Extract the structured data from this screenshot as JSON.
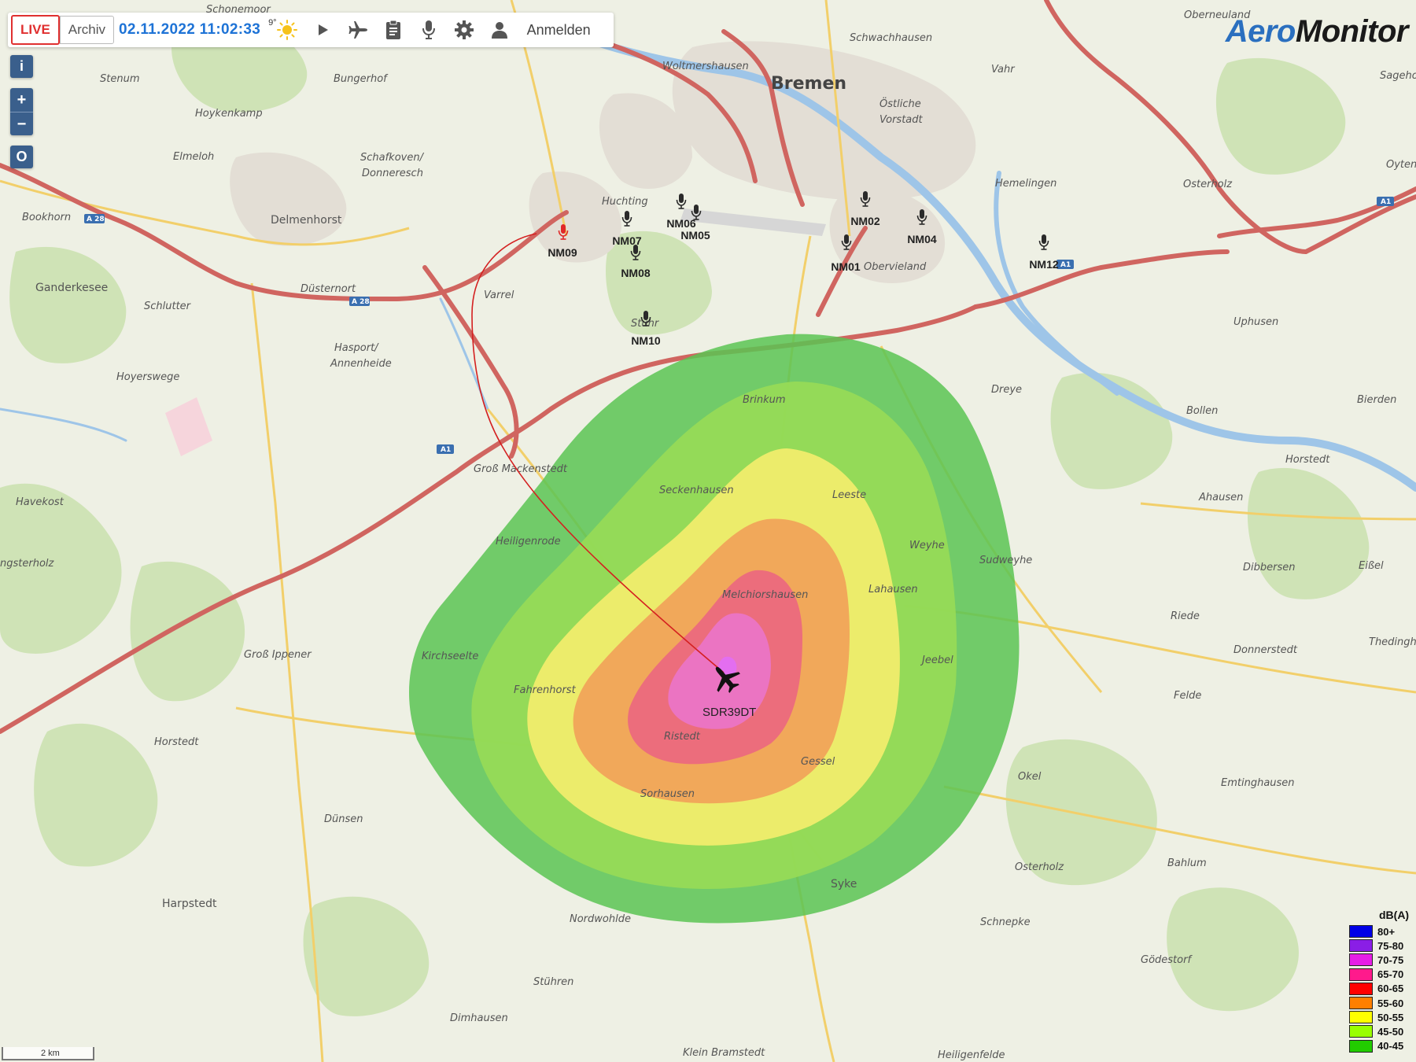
{
  "toolbar": {
    "live_label": "LIVE",
    "archive_label": "Archiv",
    "datetime": "02.11.2022 11:02:33",
    "temperature": "9°",
    "weather_icon": "sun-icon",
    "login_label": "Anmelden",
    "icons": [
      "play-icon",
      "airplane-icon",
      "clipboard-icon",
      "microphone-icon",
      "gear-icon",
      "user-icon"
    ]
  },
  "controls": {
    "info": "i",
    "zoom_in": "+",
    "zoom_out": "−",
    "overview": "O"
  },
  "logo": {
    "part1": "Aero",
    "part2": "Monitor"
  },
  "places": {
    "bremen": "Bremen",
    "schwachhausen": "Schwachhausen",
    "oestliche": "Östliche",
    "vorstadt": "Vorstadt",
    "vahr": "Vahr",
    "woltmershausen": "Woltmershausen",
    "schonemoor": "Schonemoor",
    "stenum": "Stenum",
    "bungerhof": "Bungerhof",
    "hoykenkamp": "Hoykenkamp",
    "elmeloh": "Elmeloh",
    "schafkoven": "Schafkoven/",
    "donneresch": "Donneresch",
    "huchting": "Huchting",
    "delmenhorst": "Delmenhorst",
    "bookhorn": "Bookhorn",
    "ganderkesee": "Ganderkesee",
    "schlutter": "Schlutter",
    "duesternort": "Düsternort",
    "varrel": "Varrel",
    "hasport": "Hasport/",
    "annenheide": "Annenheide",
    "hoyerswege": "Hoyerswege",
    "stuhr": "Stuhr",
    "brinkum": "Brinkum",
    "hemelingen": "Hemelingen",
    "osterholz_n": "Osterholz",
    "oberneuland": "Oberneuland",
    "sagehorn": "Sageho",
    "oyten": "Oyten",
    "obervieland": "Obervieland",
    "uphusen": "Uphusen",
    "dreye": "Dreye",
    "bollen": "Bollen",
    "bierden": "Bierden",
    "horstedt_e": "Horstedt",
    "ahausen": "Ahausen",
    "gross_mackenstedt": "Groß Mackenstedt",
    "seckenhausen": "Seckenhausen",
    "leeste": "Leeste",
    "weyhe": "Weyhe",
    "sudweyhe": "Sudweyhe",
    "havekost": "Havekost",
    "heiligenrode": "Heiligenrode",
    "ngsterholz": "ngsterholz",
    "melchiorshausen": "Melchiorshausen",
    "lahausen": "Lahausen",
    "dibbersen": "Dibbersen",
    "eissel": "Eißel",
    "riede": "Riede",
    "kirchseelte": "Kirchseelte",
    "gross_ippener": "Groß Ippener",
    "jeebel": "Jeebel",
    "donnerstedt": "Donnerstedt",
    "thedinghausen": "Thedingh",
    "fahrenhorst": "Fahrenhorst",
    "ristedt": "Ristedt",
    "felde": "Felde",
    "horstedt_w": "Horstedt",
    "gessel": "Gessel",
    "okel": "Okel",
    "sorhausen": "Sorhausen",
    "emtinghausen": "Emtinghausen",
    "duensen": "Dünsen",
    "osterholz_s": "Osterholz",
    "syke": "Syke",
    "bahlum": "Bahlum",
    "harpstedt": "Harpstedt",
    "nordwohlde": "Nordwohlde",
    "schnepke": "Schnepke",
    "goedestorf": "Gödestorf",
    "stuehren": "Stühren",
    "dimhausen": "Dimhausen",
    "klein_bramstedt": "Klein Bramstedt",
    "heiligenfelde": "Heiligenfelde"
  },
  "roads": {
    "a1_e": "A1",
    "a28_w": "A 28",
    "a28_m": "A 28",
    "a1_m": "A1",
    "a1_n": "A1"
  },
  "noise_monitors": [
    {
      "id": "NM01",
      "active": false
    },
    {
      "id": "NM02",
      "active": false
    },
    {
      "id": "NM04",
      "active": false
    },
    {
      "id": "NM05",
      "active": false
    },
    {
      "id": "NM06",
      "active": false
    },
    {
      "id": "NM07",
      "active": false
    },
    {
      "id": "NM08",
      "active": false
    },
    {
      "id": "NM09",
      "active": true
    },
    {
      "id": "NM10",
      "active": false
    },
    {
      "id": "NM12",
      "active": false
    }
  ],
  "flight": {
    "callsign": "SDR39DT",
    "icon": "airplane-icon"
  },
  "legend": {
    "title": "dB(A)",
    "items": [
      {
        "label": "80+",
        "color": "#0000e6"
      },
      {
        "label": "75-80",
        "color": "#8a1ee6"
      },
      {
        "label": "70-75",
        "color": "#e61ee6"
      },
      {
        "label": "65-70",
        "color": "#ff1a8c"
      },
      {
        "label": "60-65",
        "color": "#ff0000"
      },
      {
        "label": "55-60",
        "color": "#ff7f00"
      },
      {
        "label": "50-55",
        "color": "#ffff00"
      },
      {
        "label": "45-50",
        "color": "#99ff00"
      },
      {
        "label": "40-45",
        "color": "#22cc00"
      }
    ]
  },
  "scale": {
    "label": "2 km"
  }
}
